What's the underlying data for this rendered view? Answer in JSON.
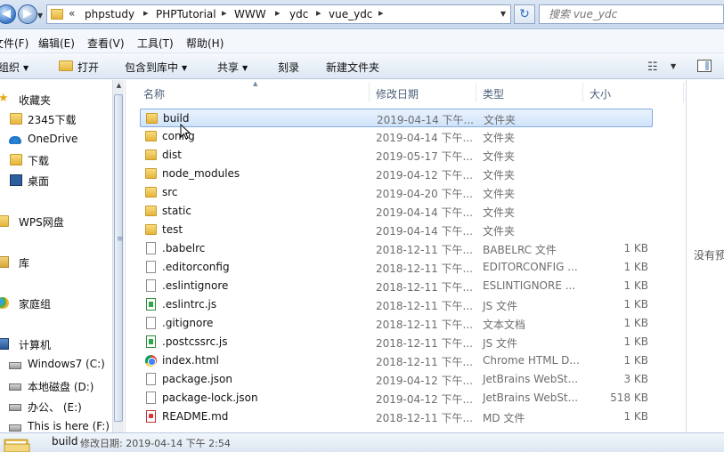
{
  "address_bar": {
    "back_glyph": "◀",
    "forward_glyph": "▶",
    "overflow": "«",
    "breadcrumbs": [
      "phpstudy",
      "PHPTutorial",
      "WWW",
      "ydc",
      "vue_ydc"
    ],
    "separator": "▸",
    "refresh_glyph": "↻",
    "search_placeholder": "搜索 vue_ydc"
  },
  "menu": [
    "文件(F)",
    "编辑(E)",
    "查看(V)",
    "工具(T)",
    "帮助(H)"
  ],
  "commands": {
    "organize": "组织",
    "open": "打开",
    "include_library": "包含到库中",
    "share": "共享",
    "burn": "刻录",
    "new_folder": "新建文件夹",
    "dropdown_glyph": "▼",
    "view_glyph": "☷"
  },
  "nav": {
    "favorites": "收藏夹",
    "favorite_items": [
      "2345下载",
      "OneDrive",
      "下载",
      "桌面"
    ],
    "wps": "WPS网盘",
    "libraries": "库",
    "homegroup": "家庭组",
    "computer": "计算机",
    "drives": [
      "Windows7 (C:)",
      "本地磁盘 (D:)",
      "办公、 (E:)",
      "This is  here (F:)"
    ],
    "scroll_up_glyph": "▲",
    "grip_glyph": "≡"
  },
  "columns": {
    "name": "名称",
    "date": "修改日期",
    "type": "类型",
    "size": "大小",
    "sort_glyph": "▲"
  },
  "files": [
    {
      "name": "build",
      "date": "2019-04-14 下午...",
      "type": "文件夹",
      "size": "",
      "icon": "folder-icon",
      "selected": true
    },
    {
      "name": "config",
      "date": "2019-04-14 下午...",
      "type": "文件夹",
      "size": "",
      "icon": "folder-icon"
    },
    {
      "name": "dist",
      "date": "2019-05-17 下午...",
      "type": "文件夹",
      "size": "",
      "icon": "folder-icon"
    },
    {
      "name": "node_modules",
      "date": "2019-04-12 下午...",
      "type": "文件夹",
      "size": "",
      "icon": "folder-icon"
    },
    {
      "name": "src",
      "date": "2019-04-20 下午...",
      "type": "文件夹",
      "size": "",
      "icon": "folder-icon"
    },
    {
      "name": "static",
      "date": "2019-04-14 下午...",
      "type": "文件夹",
      "size": "",
      "icon": "folder-icon"
    },
    {
      "name": "test",
      "date": "2019-04-14 下午...",
      "type": "文件夹",
      "size": "",
      "icon": "folder-icon"
    },
    {
      "name": ".babelrc",
      "date": "2018-12-11 下午...",
      "type": "BABELRC 文件",
      "size": "1 KB",
      "icon": "file-icon"
    },
    {
      "name": ".editorconfig",
      "date": "2018-12-11 下午...",
      "type": "EDITORCONFIG ...",
      "size": "1 KB",
      "icon": "file-icon"
    },
    {
      "name": ".eslintignore",
      "date": "2018-12-11 下午...",
      "type": "ESLINTIGNORE ...",
      "size": "1 KB",
      "icon": "file-icon"
    },
    {
      "name": ".eslintrc.js",
      "date": "2018-12-11 下午...",
      "type": "JS 文件",
      "size": "1 KB",
      "icon": "js-file-icon"
    },
    {
      "name": ".gitignore",
      "date": "2018-12-11 下午...",
      "type": "文本文档",
      "size": "1 KB",
      "icon": "file-icon"
    },
    {
      "name": ".postcssrc.js",
      "date": "2018-12-11 下午...",
      "type": "JS 文件",
      "size": "1 KB",
      "icon": "js-file-icon"
    },
    {
      "name": "index.html",
      "date": "2018-12-11 下午...",
      "type": "Chrome HTML D...",
      "size": "1 KB",
      "icon": "chrome-icon"
    },
    {
      "name": "package.json",
      "date": "2019-04-12 下午...",
      "type": "JetBrains WebSt...",
      "size": "3 KB",
      "icon": "file-icon"
    },
    {
      "name": "package-lock.json",
      "date": "2019-04-12 下午...",
      "type": "JetBrains WebSt...",
      "size": "518 KB",
      "icon": "file-icon"
    },
    {
      "name": "README.md",
      "date": "2018-12-11 下午...",
      "type": "MD 文件",
      "size": "1 KB",
      "icon": "md-file-icon"
    }
  ],
  "preview": {
    "text": "没有预"
  },
  "details": {
    "name": "build",
    "meta": "修改日期: 2019-04-14 下午 2:54"
  },
  "colors": {
    "selection_border": "#84acdd",
    "selection_fill": "#cfe3fb",
    "folder": "#e5b43c"
  }
}
